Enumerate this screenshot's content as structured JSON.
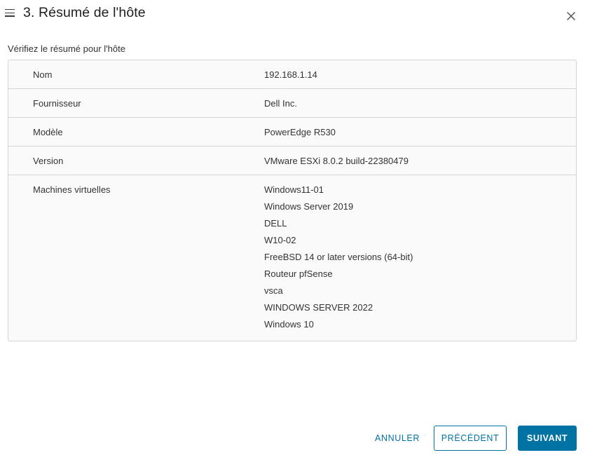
{
  "header": {
    "title": "3. Résumé de l'hôte"
  },
  "subtitle": "Vérifiez le résumé pour l'hôte",
  "summary": {
    "rows": [
      {
        "label": "Nom",
        "value": "192.168.1.14"
      },
      {
        "label": "Fournisseur",
        "value": "Dell Inc."
      },
      {
        "label": "Modèle",
        "value": "PowerEdge R530"
      },
      {
        "label": "Version",
        "value": "VMware ESXi 8.0.2 build-22380479"
      }
    ],
    "vms_label": "Machines virtuelles",
    "vms": [
      "Windows11-01",
      "Windows Server 2019",
      "DELL",
      "W10-02",
      "FreeBSD 14 or later versions (64-bit)",
      "Routeur pfSense",
      "vsca",
      "WINDOWS SERVER 2022",
      "Windows 10"
    ]
  },
  "footer": {
    "cancel_label": "ANNULER",
    "previous_label": "PRÉCÉDENT",
    "next_label": "SUIVANT"
  },
  "colors": {
    "accent": "#0072a3",
    "border": "#d4d4d4",
    "panel_bg": "#fafafa"
  },
  "icons": {
    "menu": "menu-icon",
    "close": "close-icon"
  }
}
